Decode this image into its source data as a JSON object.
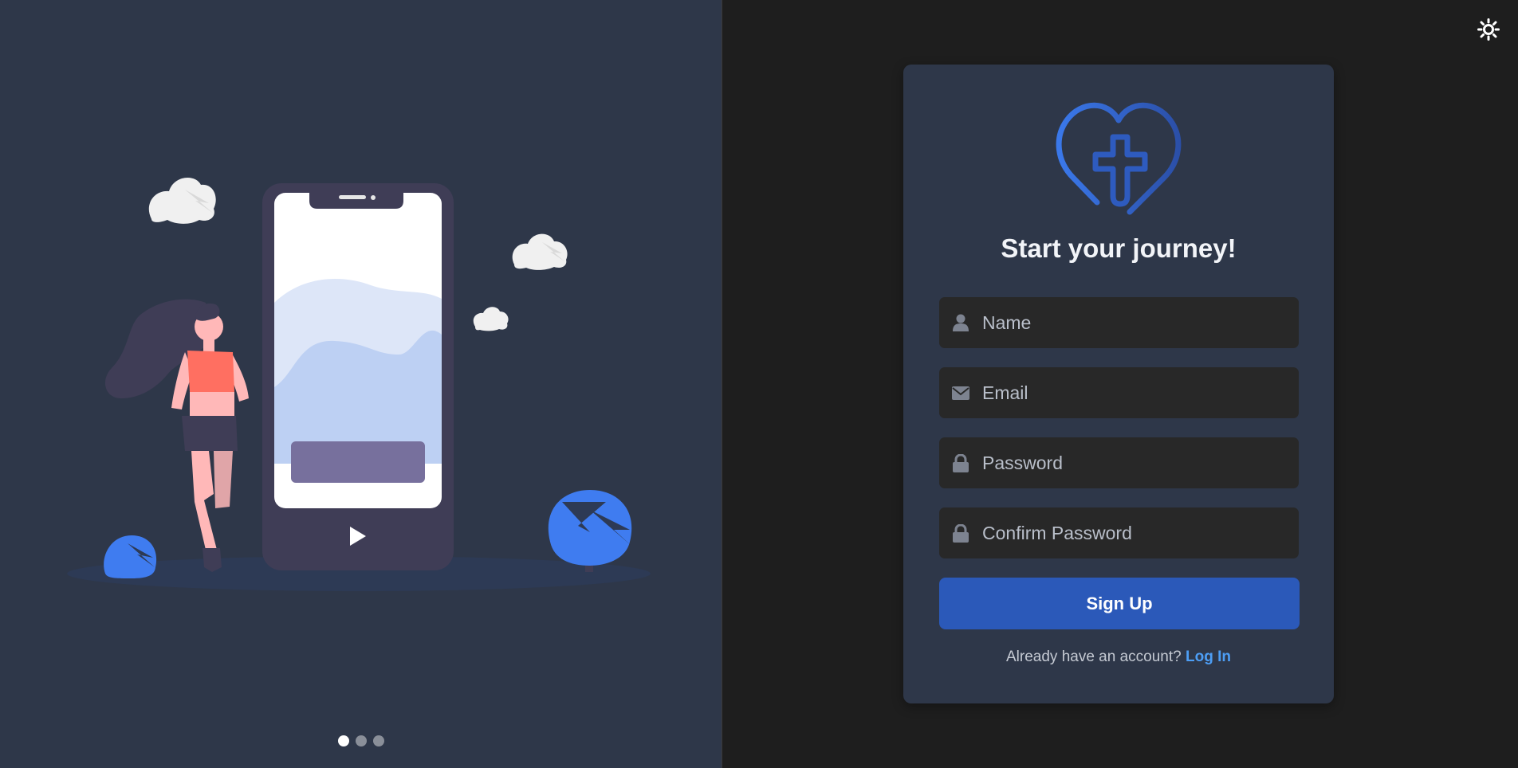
{
  "illustration": {
    "name": "woman-jogging-with-phone-illustration",
    "icons": [
      "cloud-icon",
      "play-icon",
      "bush-icon"
    ]
  },
  "carousel": {
    "slides": 3,
    "active_index": 0
  },
  "theme_toggle": {
    "icon": "sun-icon"
  },
  "card": {
    "logo_icon": "heart-cross-icon",
    "title": "Start your journey!",
    "fields": {
      "name": {
        "placeholder": "Name",
        "value": "",
        "icon": "user-icon"
      },
      "email": {
        "placeholder": "Email",
        "value": "",
        "icon": "envelope-icon"
      },
      "password": {
        "placeholder": "Password",
        "value": "",
        "icon": "lock-icon"
      },
      "confirm_password": {
        "placeholder": "Confirm Password",
        "value": "",
        "icon": "lock-icon"
      }
    },
    "signup_label": "Sign Up",
    "login_prompt": "Already have an account?",
    "login_link": "Log In"
  },
  "colors": {
    "left_bg": "#2e3749",
    "right_bg": "#1e1e1e",
    "card_bg": "#2e3749",
    "input_bg": "#282828",
    "accent": "#2b59b9",
    "link": "#4d9ef5",
    "dot_active": "#ffffff",
    "dot_inactive": "#8a8f99"
  }
}
